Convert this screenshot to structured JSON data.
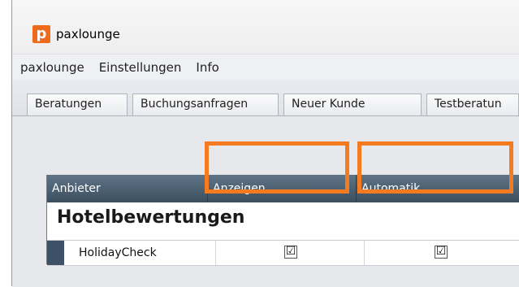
{
  "window": {
    "title": "paxlounge",
    "icon": "paxlounge-p-logo"
  },
  "menu": {
    "items": [
      "paxlounge",
      "Einstellungen",
      "Info"
    ]
  },
  "tabs": [
    "Beratungen",
    "Buchungsanfragen",
    "Neuer Kunde",
    "Testberatun"
  ],
  "grid": {
    "columns": [
      "Anbieter",
      "Anzeigen",
      "Automatik"
    ],
    "group": "Hotelbewertungen",
    "rows": [
      {
        "anbieter": "HolidayCheck",
        "anzeigen": "☑",
        "automatik": "☑"
      }
    ]
  },
  "highlight_color": "#f47b20"
}
